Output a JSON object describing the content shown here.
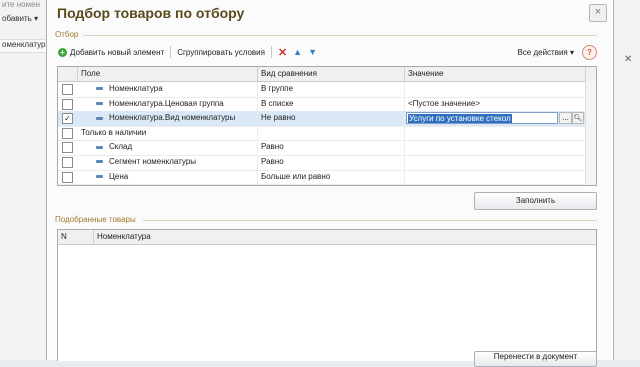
{
  "background": {
    "title_fragment": "ите номен",
    "add_fragment": "обавить ▾",
    "nom_fragment": "оменклатура"
  },
  "dialog": {
    "title": "Подбор товаров по отбору",
    "close_glyph": "×"
  },
  "filter_group": {
    "label": "Отбор",
    "toolbar": {
      "add_label": "Добавить новый элемент",
      "group_label": "Сгруппировать условия",
      "all_actions_label": "Все действия ▾",
      "help_glyph": "?"
    },
    "columns": [
      "Поле",
      "Вид сравнения",
      "Значение"
    ],
    "rows": [
      {
        "checked": false,
        "indent": 1,
        "icon": "field-dash-icon",
        "field": "Номенклатура",
        "comparison": "В группе",
        "value": ""
      },
      {
        "checked": false,
        "indent": 1,
        "icon": "field-dash-icon",
        "field": "Номенклатура.Ценовая группа",
        "comparison": "В списке",
        "value": "<Пустое значение>"
      },
      {
        "checked": true,
        "indent": 1,
        "icon": "field-dash-icon",
        "field": "Номенклатура.Вид номенклатуры",
        "comparison": "Не равно",
        "value": "Услуги по установке стекол",
        "selected": true
      },
      {
        "checked": false,
        "indent": 0,
        "icon": "",
        "field": "Только в наличии",
        "comparison": "",
        "value": ""
      },
      {
        "checked": false,
        "indent": 1,
        "icon": "field-dash-icon",
        "field": "Склад",
        "comparison": "Равно",
        "value": ""
      },
      {
        "checked": false,
        "indent": 1,
        "icon": "field-dash-icon",
        "field": "Сегмент номенклатуры",
        "comparison": "Равно",
        "value": ""
      },
      {
        "checked": false,
        "indent": 1,
        "icon": "field-dash-icon",
        "field": "Цена",
        "comparison": "Больше или равно",
        "value": ""
      }
    ],
    "value_dots": "...",
    "fill_button": "Заполнить"
  },
  "selected_group": {
    "label": "Подобранные товары",
    "columns": [
      "N",
      "Номенклатура"
    ],
    "bottom_button": "Перенести в документ"
  },
  "colors": {
    "title": "#5b4a1e",
    "group_label": "#a07a2e",
    "selection": "#3070c0",
    "selected_row": "#dbe8f7"
  }
}
